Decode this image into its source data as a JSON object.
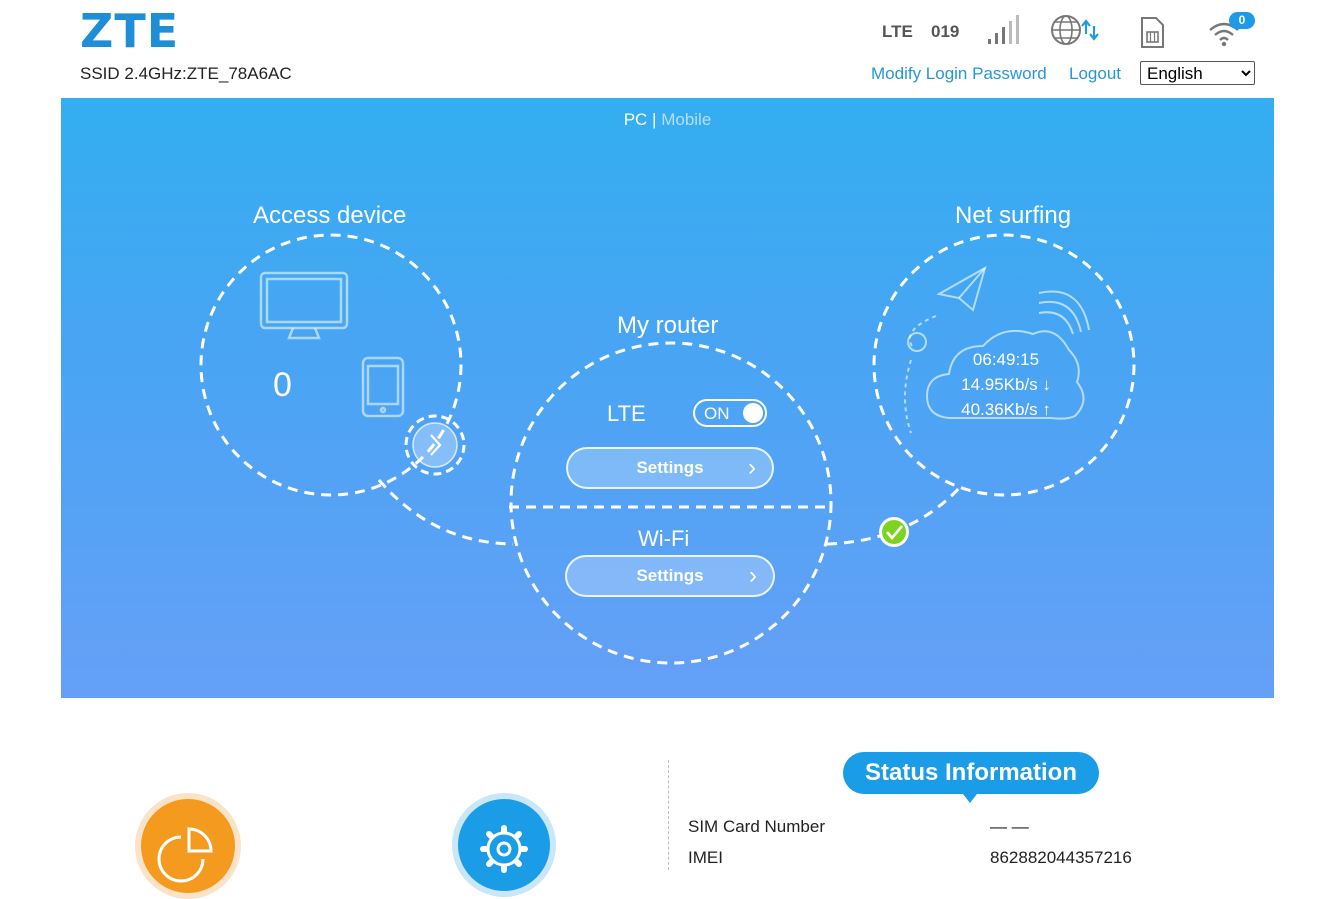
{
  "header": {
    "logo": "ZTE",
    "ssid": "SSID 2.4GHz:ZTE_78A6AC",
    "network_type": "LTE",
    "operator_code": "019",
    "wifi_clients_badge": "0",
    "modify_password_label": "Modify Login Password",
    "logout_label": "Logout",
    "language_selected": "English",
    "icons": [
      "signal-strength-icon",
      "globe-data-icon",
      "sim-card-icon",
      "wifi-icon"
    ]
  },
  "hero": {
    "view_pc": "PC",
    "view_separator": " | ",
    "view_mobile": "Mobile",
    "access_device": {
      "title": "Access device",
      "count": "0"
    },
    "my_router": {
      "title": "My router",
      "lte_label": "LTE",
      "lte_toggle": "ON",
      "lte_settings": "Settings",
      "wifi_label": "Wi-Fi",
      "wifi_settings": "Settings"
    },
    "net_surfing": {
      "title": "Net surfing",
      "duration": "06:49:15",
      "download": "14.95Kb/s ↓",
      "upload": "40.36Kb/s ↑"
    }
  },
  "status": {
    "title": "Status Information",
    "rows": [
      {
        "label": "SIM Card Number",
        "value": "— —"
      },
      {
        "label": "IMEI",
        "value": "862882044357216"
      }
    ]
  },
  "colors": {
    "brand": "#1e8fd6",
    "accent": "#1a9de6",
    "orange": "#f39a1f",
    "ok_green": "#7ed321"
  }
}
